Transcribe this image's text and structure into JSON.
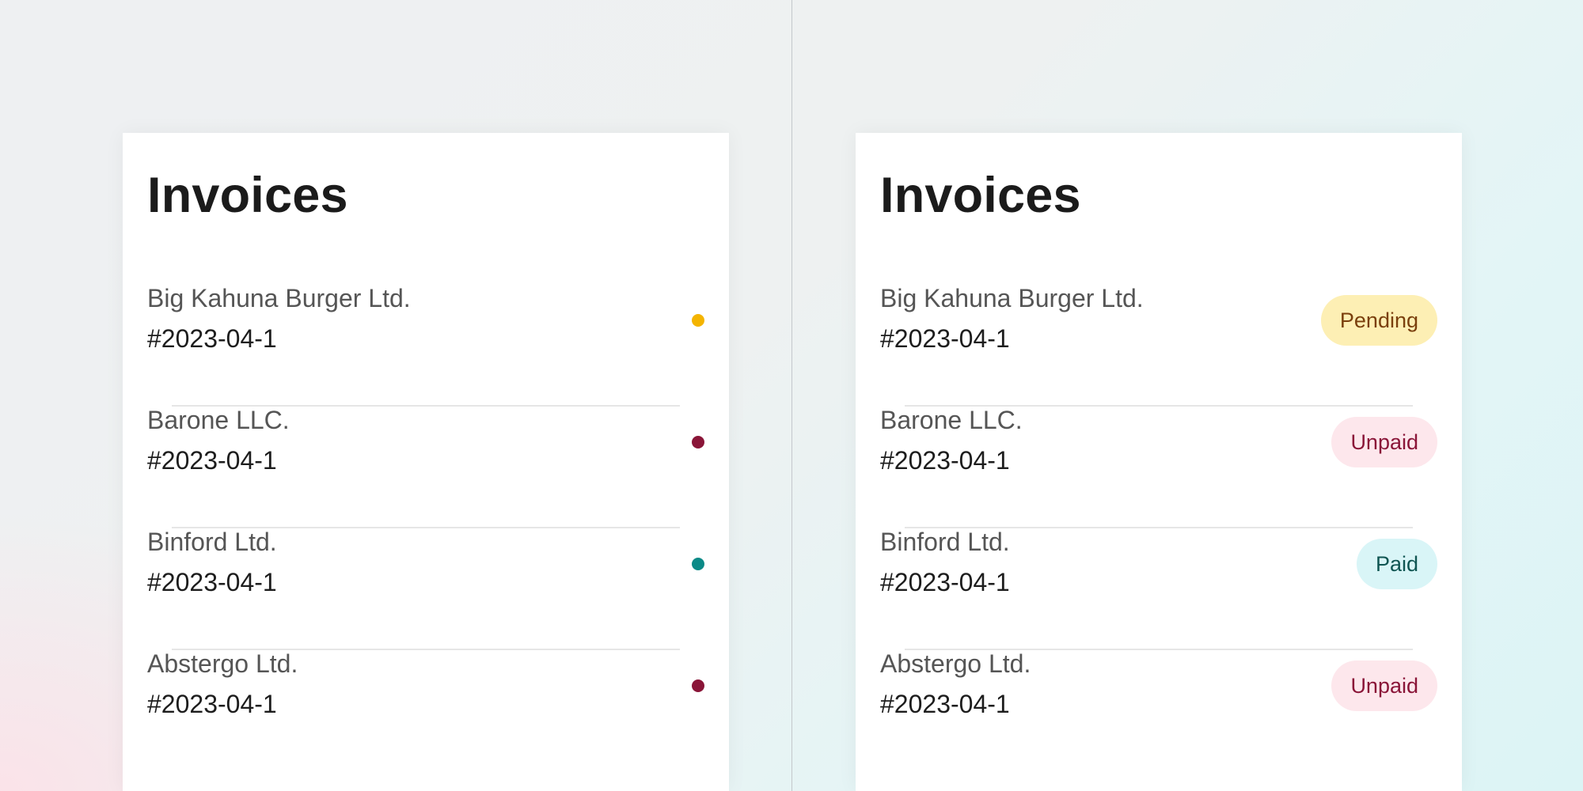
{
  "status_styles": {
    "Pending": {
      "dot": "#f4b400",
      "bg": "#fdefb4",
      "fg": "#7a3f0c"
    },
    "Unpaid": {
      "dot": "#8a1538",
      "bg": "#fde7ec",
      "fg": "#8a1538"
    },
    "Paid": {
      "dot": "#0b8a87",
      "bg": "#d9f5f7",
      "fg": "#0f5552"
    }
  },
  "left_card": {
    "title": "Invoices",
    "invoices": [
      {
        "customer": "Big Kahuna Burger Ltd.",
        "number": "#2023-04-1",
        "status": "Pending"
      },
      {
        "customer": "Barone LLC.",
        "number": "#2023-04-1",
        "status": "Unpaid"
      },
      {
        "customer": "Binford Ltd.",
        "number": "#2023-04-1",
        "status": "Paid"
      },
      {
        "customer": "Abstergo Ltd.",
        "number": "#2023-04-1",
        "status": "Unpaid"
      }
    ]
  },
  "right_card": {
    "title": "Invoices",
    "invoices": [
      {
        "customer": "Big Kahuna Burger Ltd.",
        "number": "#2023-04-1",
        "status": "Pending"
      },
      {
        "customer": "Barone LLC.",
        "number": "#2023-04-1",
        "status": "Unpaid"
      },
      {
        "customer": "Binford Ltd.",
        "number": "#2023-04-1",
        "status": "Paid"
      },
      {
        "customer": "Abstergo Ltd.",
        "number": "#2023-04-1",
        "status": "Unpaid"
      }
    ]
  }
}
